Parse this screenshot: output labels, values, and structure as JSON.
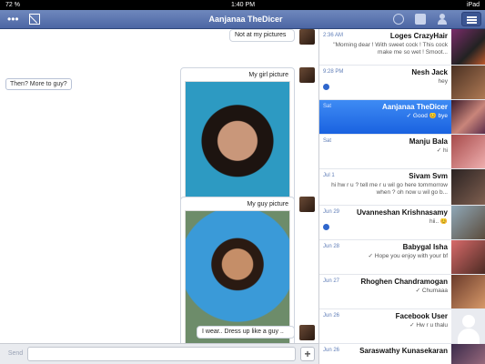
{
  "status_bar": {
    "battery": "72 %",
    "time": "1:40 PM",
    "device": "iPad"
  },
  "nav": {
    "title": "Aanjanaa TheDicer"
  },
  "conversation": {
    "left_message": "Then? More to guy?",
    "messages": [
      {
        "text": "Not at my pictures"
      },
      {
        "caption": "My girl picture"
      },
      {
        "caption": "My guy picture"
      },
      {
        "text": "I wear.. Dress up like a guy .."
      }
    ]
  },
  "input": {
    "send_label": "Send",
    "add_label": "+"
  },
  "contacts": [
    {
      "name": "Loges CrazyHair",
      "time": "2:36 AM",
      "snippet": "\"Morning dear ! With sweet cock ! This cock make me so wet ! Smoot..."
    },
    {
      "name": "Nesh Jack",
      "time": "9:28 PM",
      "snippet": "hey"
    },
    {
      "name": "Aanjanaa TheDicer",
      "time": "Sat",
      "snippet": "✓ Good 😊 bye"
    },
    {
      "name": "Manju Bala",
      "time": "Sat",
      "snippet": "✓ hi"
    },
    {
      "name": "Sivam Svm",
      "time": "Jul 1",
      "snippet": "hi hw r u ? tell me r u wil go here tommorrow when ? oh now u wil go b..."
    },
    {
      "name": "Uvanneshan Krishnasamy",
      "time": "Jun 29",
      "snippet": "hii.. 😊"
    },
    {
      "name": "Babygal Isha",
      "time": "Jun 28",
      "snippet": "✓ Hope you enjoy with your bf"
    },
    {
      "name": "Rhoghen Chandramogan",
      "time": "Jun 27",
      "snippet": "✓ Chumaaa"
    },
    {
      "name": "Facebook User",
      "time": "Jun 26",
      "snippet": "✓ Hw r u thalu"
    },
    {
      "name": "Saraswathy Kunasekaran",
      "time": "Jun 26",
      "snippet": ""
    }
  ]
}
